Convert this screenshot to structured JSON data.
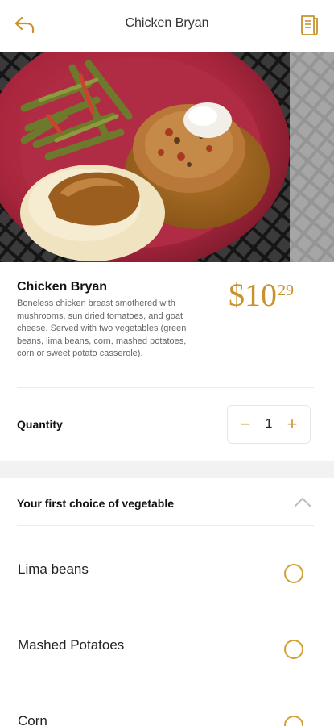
{
  "header": {
    "title": "Chicken Bryan",
    "back_icon": "back-arrow-icon",
    "menu_icon": "receipt-icon"
  },
  "item": {
    "name": "Chicken Bryan",
    "description": " Boneless chicken breast smothered with mushrooms, sun dried tomatoes, and goat cheese. Served with two vegetables (green beans, lima beans, corn, mashed potatoes, corn or sweet potato casserole).",
    "price_main": "$10",
    "price_cents": "29"
  },
  "quantity": {
    "label": "Quantity",
    "value": "1",
    "minus": "−",
    "plus": "+"
  },
  "vegetable_choice": {
    "title": "Your first choice of vegetable",
    "options": [
      {
        "label": "Lima beans"
      },
      {
        "label": "Mashed Potatoes"
      },
      {
        "label": "Corn"
      }
    ]
  },
  "colors": {
    "accent": "#c9922c",
    "radio": "#d4a035",
    "band": "#f2f2f2"
  }
}
